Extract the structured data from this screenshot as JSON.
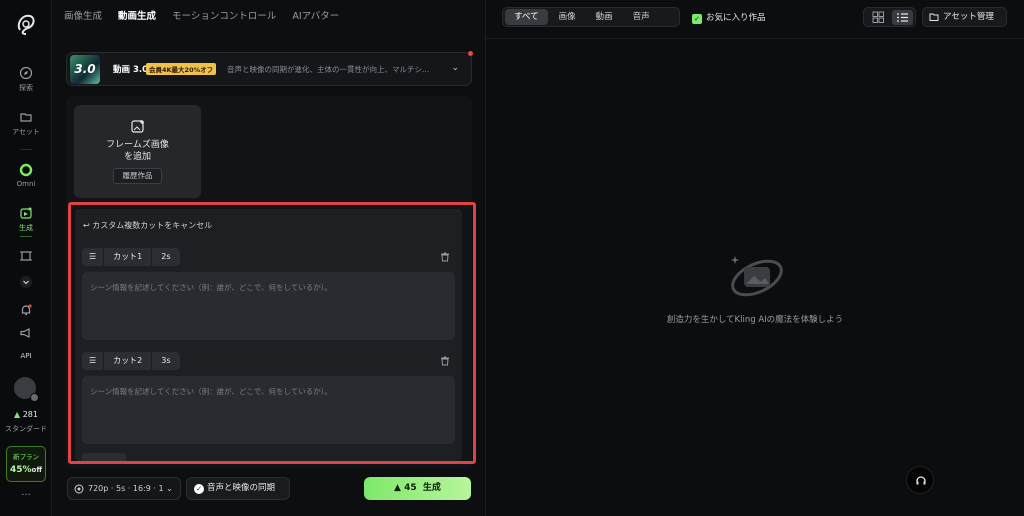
{
  "nav": {
    "tabs": [
      {
        "label": "画像生成"
      },
      {
        "label": "動画生成"
      },
      {
        "label": "モーションコントロール"
      },
      {
        "label": "AIアバター"
      }
    ],
    "active_index": 1
  },
  "sidebar": {
    "items": [
      {
        "label": "探索"
      },
      {
        "label": "アセット"
      },
      {
        "label": "Omni"
      },
      {
        "label": "生成"
      },
      {
        "label": "API"
      }
    ],
    "credits": "281",
    "plan": "スタンダード",
    "promo_title": "新プラン",
    "promo_value": "45%",
    "promo_suffix": "off",
    "more": "···"
  },
  "model": {
    "thumb_text": "3.0",
    "name": "動画 3.0",
    "badge": "会員4K最大20%オフ",
    "description": "音声と映像の同期が進化、主体の一貫性が向上、マルチシ..."
  },
  "frames": {
    "add_label_line1": "フレームズ画像",
    "add_label_line2": "を追加",
    "history_button": "履歴作品"
  },
  "cuts": {
    "cancel_label": "カスタム複数カットをキャンセル",
    "items": [
      {
        "name": "カット1",
        "duration": "2s",
        "placeholder": "シーン情報を記述してください（例：誰が、どこで、何をしているか）。"
      },
      {
        "name": "カット2",
        "duration": "3s",
        "placeholder": "シーン情報を記述してください（例：誰が、どこで、何をしているか）。"
      }
    ]
  },
  "bottom": {
    "options": "720p · 5s · 16:9 · 1",
    "sync_label": "音声と映像の同期",
    "generate_cost": "45",
    "generate_label": "生成"
  },
  "right": {
    "filters": [
      "すべて",
      "画像",
      "動画",
      "音声"
    ],
    "active_filter": 0,
    "favorites_label": "お気に入り作品",
    "asset_button": "アセット管理",
    "empty_text": "創造力を生かしてKling AIの魔法を体験しよう"
  },
  "colors": {
    "accent": "#7ee86b",
    "highlight": "#e04346",
    "badge": "#f1c24a"
  }
}
